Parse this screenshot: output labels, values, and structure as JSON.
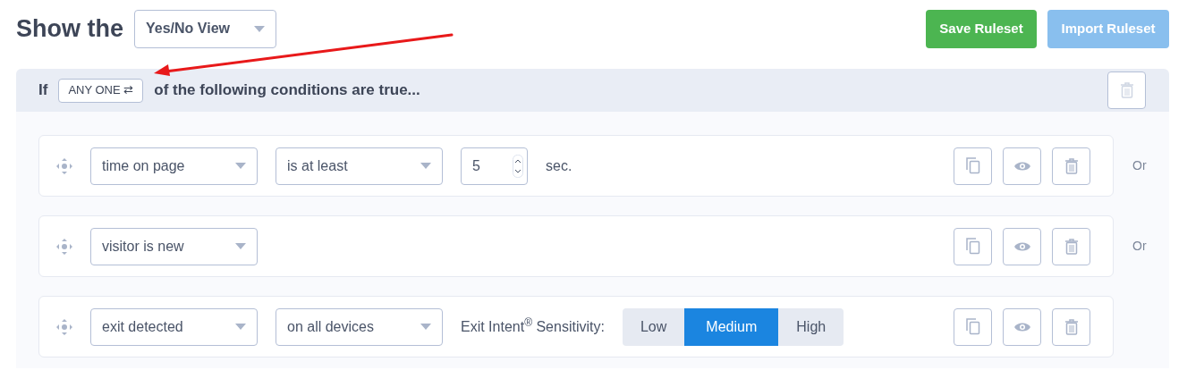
{
  "header": {
    "title": "Show the",
    "view_select": "Yes/No View",
    "buttons": [
      {
        "label": "Save Ruleset",
        "kind": "primary"
      },
      {
        "label": "Import Ruleset",
        "kind": "secondary"
      }
    ]
  },
  "condition_group": {
    "prefix": "If",
    "match_toggle": "ANY ONE ⇄",
    "suffix": "of the following conditions are true...",
    "rows": [
      {
        "fields": [
          {
            "kind": "select",
            "value": "time on page"
          },
          {
            "kind": "select",
            "value": "is at least"
          },
          {
            "kind": "number",
            "value": "5"
          },
          {
            "kind": "text",
            "value": "sec."
          }
        ],
        "joiner": "Or"
      },
      {
        "fields": [
          {
            "kind": "select",
            "value": "visitor is new"
          }
        ],
        "joiner": "Or"
      },
      {
        "fields": [
          {
            "kind": "select",
            "value": "exit detected"
          },
          {
            "kind": "select",
            "value": "on all devices"
          },
          {
            "kind": "text",
            "value": "Exit Intent$^{®}$ Sensitivity:"
          },
          {
            "kind": "segmented",
            "options": [
              {
                "label": "Low",
                "selected": false
              },
              {
                "label": "Medium",
                "selected": true
              },
              {
                "label": "High",
                "selected": false
              }
            ]
          }
        ]
      }
    ]
  }
}
